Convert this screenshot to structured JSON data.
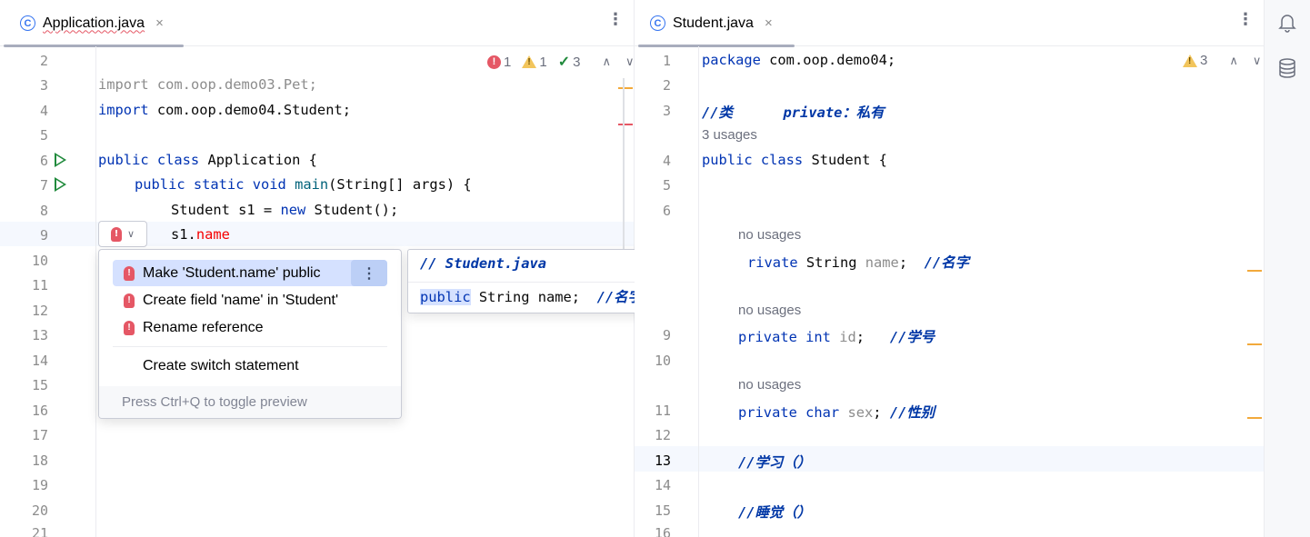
{
  "left_editor": {
    "tab": {
      "icon": "C",
      "title": "Application.java",
      "close": "×"
    },
    "more": "⋮",
    "inspections": {
      "errors": "1",
      "warnings": "1",
      "weak_warnings": "3"
    },
    "line_numbers": [
      "2",
      "3",
      "4",
      "5",
      "6",
      "7",
      "8",
      "9",
      "10",
      "11",
      "12",
      "13",
      "14",
      "15",
      "16",
      "17",
      "18",
      "19",
      "20",
      "21"
    ],
    "code": {
      "l3_kw": "import",
      "l3_rest": " com.oop.demo03.Pet;",
      "l4_kw": "import",
      "l4_rest": " com.oop.demo04.Student;",
      "l6_kw": "public class",
      "l6_rest": " Application {",
      "l7_kw": "public static void",
      "l7_fn": "main",
      "l7_rest": "(String[] args) {",
      "l8_a": "Student s1 = ",
      "l8_kw": "new",
      "l8_b": " Student();",
      "l9_a": "s1.",
      "l9_err": "name"
    }
  },
  "popup": {
    "items": [
      "Make 'Student.name' public",
      "Create field 'name' in 'Student'",
      "Rename reference",
      "Create switch statement"
    ],
    "more": "⋮",
    "footer": "Press Ctrl+Q to toggle preview"
  },
  "preview": {
    "header": "// Student.java",
    "code_kw": "public",
    "code_rest": " String name;  ",
    "code_cmt": "//名字"
  },
  "right_editor": {
    "tab": {
      "icon": "C",
      "title": "Student.java",
      "close": "×"
    },
    "more": "⋮",
    "inspections": {
      "warnings": "3"
    },
    "line_numbers": [
      "1",
      "2",
      "3",
      "4",
      "5",
      "6",
      "9",
      "10",
      "11",
      "12",
      "13",
      "14",
      "15",
      "16"
    ],
    "code": {
      "l1_kw": "package",
      "l1_rest": " com.oop.demo04;",
      "l3": "//类      private：私有",
      "usages_3": "3 usages",
      "l4_kw": "public class",
      "l4_rest": " Student {",
      "no_usages": "no usages",
      "name_kw": "rivate",
      "name_type": " String ",
      "name_field": "name",
      "name_semi": ";  ",
      "name_cmt": "//名字",
      "id_kw": "private int",
      "id_field": " id",
      "id_semi": ";   ",
      "id_cmt": "//学号",
      "sex_kw": "private char",
      "sex_field": " sex",
      "sex_semi": "; ",
      "sex_cmt": "//性别",
      "l13": "//学习（）",
      "l15": "//睡觉（）"
    }
  },
  "colors": {
    "keyword": "#0033b3",
    "error": "#f50000",
    "comment": "#0037a6",
    "accent": "#3574f0",
    "warning_stripe": "#f2a93b"
  }
}
